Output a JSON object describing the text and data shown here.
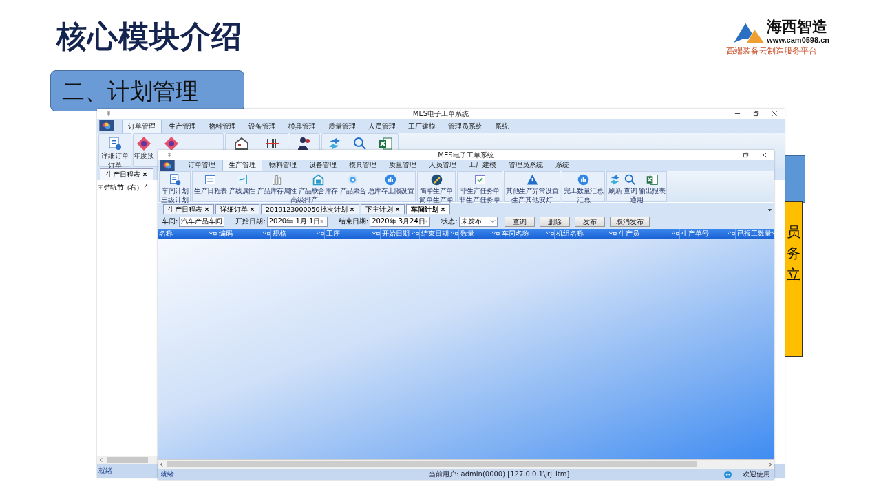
{
  "slide": {
    "title": "核心模块介绍",
    "logo": {
      "name": "海西智造",
      "url": "www.cam0598.cn",
      "slogan": "高端装备云制造服务平台"
    },
    "section": "二、计划管理",
    "side_fragments": [
      "员",
      "务",
      "立"
    ]
  },
  "back_window": {
    "title": "MES电子工单系统",
    "menu": [
      {
        "label": "订单管理",
        "selected": true
      },
      {
        "label": "生产管理",
        "selected": false
      },
      {
        "label": "物料管理",
        "selected": false
      },
      {
        "label": "设备管理",
        "selected": false
      },
      {
        "label": "模具管理",
        "selected": false
      },
      {
        "label": "质量管理",
        "selected": false
      },
      {
        "label": "人员管理",
        "selected": false
      },
      {
        "label": "工厂建模",
        "selected": false
      },
      {
        "label": "管理员系统",
        "selected": false
      },
      {
        "label": "系统",
        "selected": false
      }
    ],
    "toolbar": [
      "详细订单",
      "年度预"
    ],
    "group": "订单",
    "tab": "生产日程表",
    "tree": [
      {
        "label": "链轨节（右） 4I-",
        "expanded": false
      }
    ],
    "status": "就绪"
  },
  "front_window": {
    "title": "MES电子工单系统",
    "menu": [
      {
        "label": "订单管理",
        "selected": false
      },
      {
        "label": "生产管理",
        "selected": true
      },
      {
        "label": "物料管理",
        "selected": false
      },
      {
        "label": "设备管理",
        "selected": false
      },
      {
        "label": "模具管理",
        "selected": false
      },
      {
        "label": "质量管理",
        "selected": false
      },
      {
        "label": "人员管理",
        "selected": false
      },
      {
        "label": "工厂建模",
        "selected": false
      },
      {
        "label": "管理员系统",
        "selected": false
      },
      {
        "label": "系统",
        "selected": false
      }
    ],
    "ribbon": [
      {
        "label": "三级计划",
        "buttons": [
          "车间计划"
        ]
      },
      {
        "label": "高级排产",
        "buttons": [
          "生产日程表",
          "产线属性",
          "产品库存属性",
          "产品联合库存",
          "产品聚合",
          "总库存上限设置"
        ]
      },
      {
        "label": "简单生产单",
        "buttons": [
          "简单生产单"
        ]
      },
      {
        "label": "非生产任务单",
        "buttons": [
          "非生产任务单"
        ]
      },
      {
        "label": "生产其他安灯",
        "buttons": [
          "其他生产异常设置"
        ]
      },
      {
        "label": "汇总",
        "buttons": [
          "完工数量汇总"
        ]
      },
      {
        "label": "通用",
        "buttons": [
          "刷新",
          "查询",
          "输出报表"
        ]
      }
    ],
    "tabs": [
      {
        "label": "生产日程表",
        "selected": false
      },
      {
        "label": "详细订单",
        "selected": false
      },
      {
        "label": "2019123000050批次计划",
        "selected": false
      },
      {
        "label": "下主计划",
        "selected": false
      },
      {
        "label": "车间计划",
        "selected": true
      }
    ],
    "filters": {
      "workshop_label": "车间:",
      "workshop": "汽车产品车间",
      "start_label": "开始日期:",
      "start": "2020年  1月  1日",
      "end_label": "结束日期:",
      "end": "2020年  3月24日",
      "status_label": "状态:",
      "status": "未发布"
    },
    "actions": [
      "查询",
      "删除",
      "发布",
      "取消发布"
    ],
    "columns": [
      "名称",
      "编码",
      "规格",
      "工序",
      "开始日期",
      "结束日期",
      "数量",
      "车间名称",
      "机组名称",
      "生产员",
      "生产单号",
      "已报工数量"
    ],
    "status": {
      "left": "就绪",
      "user": "当前用户: admin(0000) [127.0.0.1\\jrj_itm]",
      "right": "欢迎使用"
    }
  }
}
